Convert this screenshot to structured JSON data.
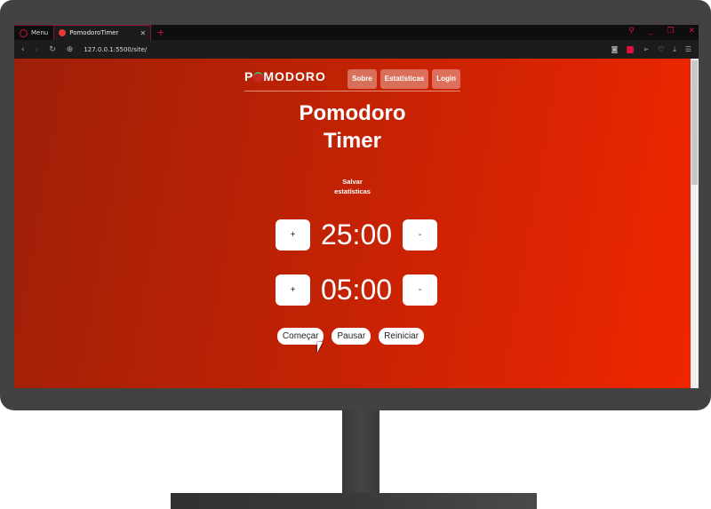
{
  "browser": {
    "menu_label": "Menu",
    "tab_title": "PomodoroTimer",
    "url": "127.0.0.1:5500/site/"
  },
  "site": {
    "logo": "POMODORO",
    "nav": [
      "Sobre",
      "Estatísticas",
      "Login"
    ],
    "title_line1": "Pomodoro",
    "title_line2": "Timer",
    "save_line1": "Salvar",
    "save_line2": "estatísticas",
    "focus": {
      "plus": "+",
      "time": "25:00",
      "minus": "-"
    },
    "break": {
      "plus": "+",
      "time": "05:00",
      "minus": "-"
    },
    "controls": [
      "Começar",
      "Pausar",
      "Reiniciar"
    ]
  },
  "colors": {
    "accent": "#d0103a",
    "page_start": "#9e2008",
    "page_end": "#f02600"
  }
}
